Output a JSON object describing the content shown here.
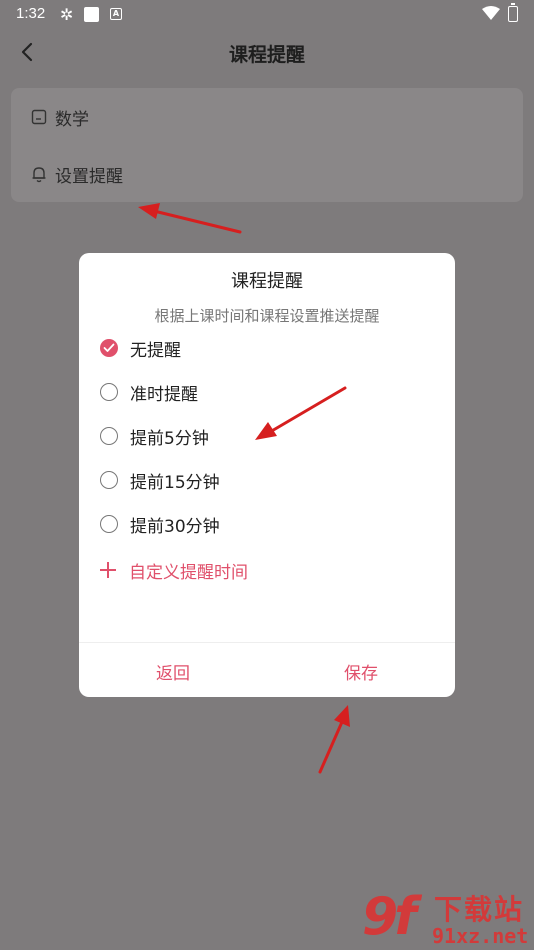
{
  "status_bar": {
    "time": "1:32",
    "icons": [
      "pinwheel-icon",
      "square-icon",
      "a-badge-icon",
      "wifi-icon",
      "battery-icon"
    ]
  },
  "header": {
    "title": "课程提醒",
    "back_icon": "chevron-left-icon"
  },
  "settings": {
    "items": [
      {
        "label": "数学",
        "icon": "note-icon"
      },
      {
        "label": "设置提醒",
        "icon": "bell-icon"
      }
    ]
  },
  "dialog": {
    "title": "课程提醒",
    "subtitle": "根据上课时间和课程设置推送提醒",
    "options": [
      {
        "label": "无提醒",
        "selected": true
      },
      {
        "label": "准时提醒",
        "selected": false
      },
      {
        "label": "提前5分钟",
        "selected": false
      },
      {
        "label": "提前15分钟",
        "selected": false
      },
      {
        "label": "提前30分钟",
        "selected": false
      }
    ],
    "custom_label": "自定义提醒时间",
    "cancel_label": "返回",
    "save_label": "保存"
  },
  "watermark": {
    "logo": "9f",
    "text1": "下载站",
    "text2": "91xz.net"
  },
  "colors": {
    "accent": "#e0506b",
    "overlay": "#7e7b7c",
    "arrow": "#d61f1f"
  }
}
